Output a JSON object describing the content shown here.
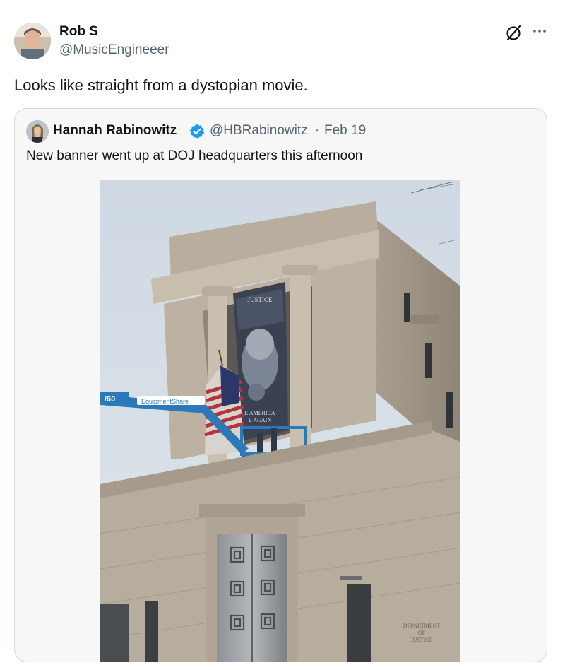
{
  "tweet": {
    "author": {
      "name": "Rob S",
      "handle": "@MusicEngineeer",
      "avatar_icon": "avatar-photo"
    },
    "text": "Looks like straight from a dystopian movie.",
    "actions": {
      "grok_icon": "grok-icon",
      "more_icon": "more-icon"
    }
  },
  "quoted": {
    "author": {
      "name": "Hannah Rabinowitz",
      "verified": true,
      "verified_color": "#1d9bf0",
      "handle": "@HBRabinowitz",
      "separator": "·",
      "date": "Feb 19"
    },
    "text": "New banner went up at DOJ headquarters this afternoon",
    "image": {
      "description_icon": "photo",
      "banner_top_text": "JUSTICE",
      "banner_bottom_lines": [
        "E AMERICA",
        "E AGAIN"
      ],
      "lift_number": "/60",
      "lift_brand": "EquipmentShare",
      "engraving_lines": [
        "DEPARTMENT",
        "OF",
        "JUSTICE"
      ]
    }
  },
  "colors": {
    "text_primary": "#0f1419",
    "text_secondary": "#536471",
    "border": "#cfd9de",
    "card_bg": "#f7f7f7",
    "accent": "#1d9bf0"
  }
}
